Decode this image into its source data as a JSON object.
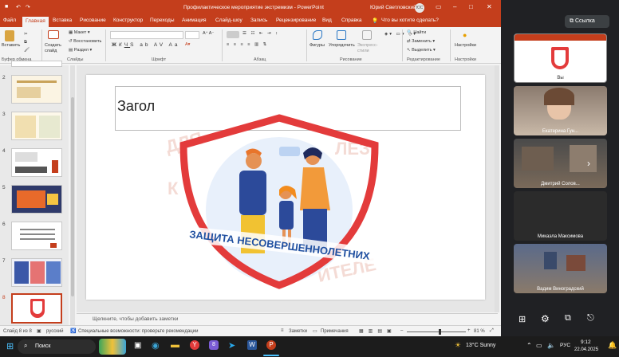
{
  "app": {
    "doc_title": "Профилактическое мероприятие экстремизм  -  PowerPoint",
    "user": "Юрий Светловский",
    "user_initials": "ЮС",
    "search_prompt": "Что вы хотите сделать?"
  },
  "tabs": [
    "Файл",
    "Главная",
    "Вставка",
    "Рисование",
    "Конструктор",
    "Переходы",
    "Анимация",
    "Слайд-шоу",
    "Запись",
    "Рецензирование",
    "Вид",
    "Справка"
  ],
  "ribbon": {
    "paste": "Вставить",
    "create_slide": "Создать слайд",
    "layout": "Макет",
    "reset": "Восстановить",
    "section": "Раздел",
    "shapes": "Фигуры",
    "arrange": "Упорядочить",
    "quick_styles": "Экспресс-стили",
    "find": "Найти",
    "replace": "Заменить",
    "select": "Выделить",
    "designer": "Настройки",
    "groups": {
      "clipboard": "Буфер обмена",
      "slides": "Слайды",
      "font": "Шрифт",
      "paragraph": "Абзац",
      "drawing": "Рисование",
      "editing": "Редактирование",
      "designer": "Настройки"
    }
  },
  "thumbnails": [
    "2",
    "3",
    "4",
    "5",
    "6",
    "7",
    "8"
  ],
  "slide": {
    "title_text": "Загол",
    "logo_text": "ЗАЩИТА НЕСОВЕРШЕННОЛЕТНИХ"
  },
  "notes_placeholder": "Щелкните, чтобы добавить заметки",
  "status": {
    "slide_of": "Слайд 8 из 8",
    "language": "русский",
    "accessibility": "Специальные возможности: проверьте рекомендации",
    "notes": "Заметки",
    "comments": "Примечания",
    "zoom": "81 %"
  },
  "meet": {
    "link_button": "Ссылка",
    "participants": [
      "Вы",
      "Екатерина Гун...",
      "Дмитрий Солов...",
      "Микаэла Максимова",
      "Вадим Виноградский"
    ]
  },
  "taskbar": {
    "search": "Поиск",
    "weather": "13°C  Sunny",
    "lang": "РУС",
    "time": "9:12",
    "date": "22.04.2025",
    "badge_count": "8"
  },
  "colors": {
    "accent": "#c43e1c",
    "shield_red": "#e33b3b",
    "logo_blue": "#1f4fa0"
  }
}
